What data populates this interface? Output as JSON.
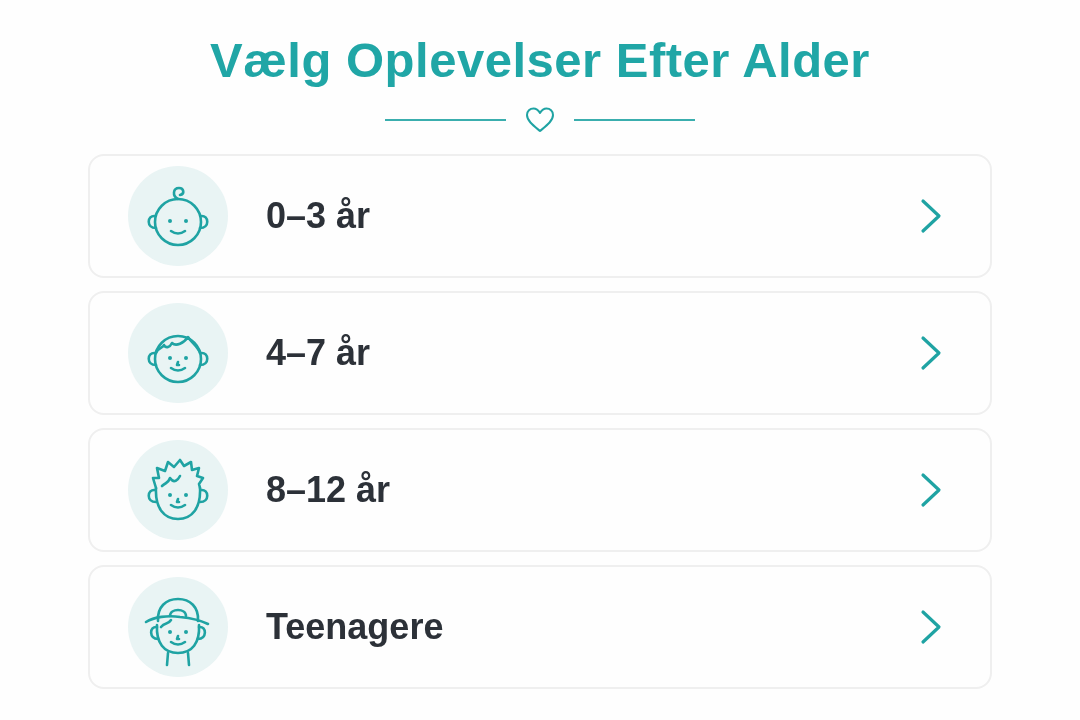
{
  "title": "Vælg Oplevelser Efter Alder",
  "age_groups": [
    {
      "label": "0–3 år"
    },
    {
      "label": "4–7 år"
    },
    {
      "label": "8–12 år"
    },
    {
      "label": "Teenagere"
    }
  ]
}
